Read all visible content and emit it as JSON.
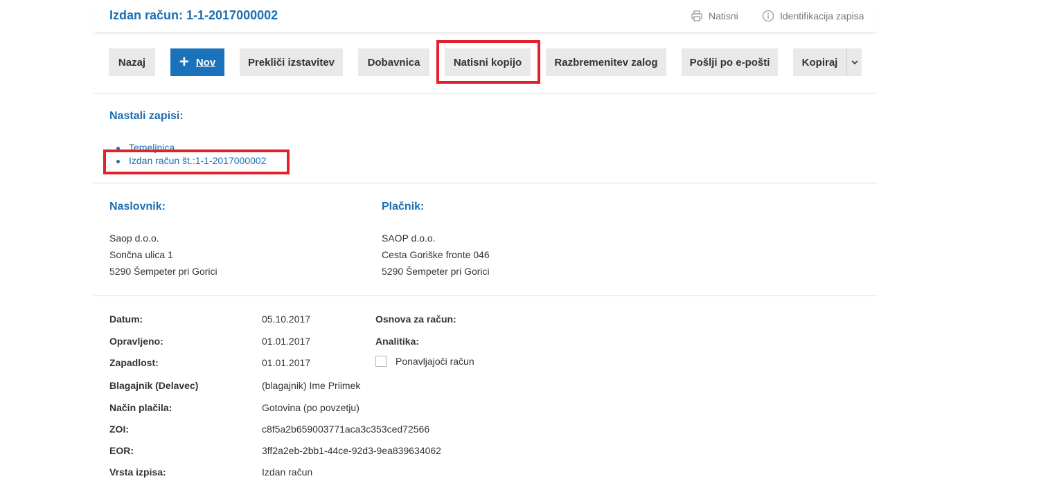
{
  "header": {
    "title": "Izdan račun: 1-1-2017000002",
    "print_label": "Natisni",
    "print_icon": "printer-icon",
    "info_label": "Identifikacija zapisa",
    "info_icon": "info-icon"
  },
  "toolbar": {
    "back": "Nazaj",
    "new": "Nov",
    "new_icon": "plus-icon",
    "cancel_issue": "Prekliči izstavitev",
    "delivery_note": "Dobavnica",
    "print_copy": "Natisni kopijo",
    "release_stock": "Razbremenitev zalog",
    "send_email": "Pošlji po e-pošti",
    "copy": "Kopiraj",
    "copy_menu_icon": "chevron-down-icon"
  },
  "records": {
    "title": "Nastali zapisi:",
    "items": [
      "Temeljnica",
      "Izdan račun št.:1-1-2017000002"
    ]
  },
  "recipient": {
    "title": "Naslovnik:",
    "name": "Saop d.o.o.",
    "street": "Sončna ulica 1",
    "city": "5290 Šempeter pri Gorici"
  },
  "payer": {
    "title": "Plačnik:",
    "name": "SAOP d.o.o.",
    "street": "Cesta Goriške fronte 046",
    "city": "5290 Šempeter pri Gorici"
  },
  "details": {
    "date_label": "Datum:",
    "date_value": "05.10.2017",
    "done_label": "Opravljeno:",
    "done_value": "01.01.2017",
    "due_label": "Zapadlost:",
    "due_value": "01.01.2017",
    "cashier_label": "Blagajnik (Delavec)",
    "cashier_value": "(blagajnik) Ime Priimek",
    "payment_label": "Način plačila:",
    "payment_value": "Gotovina (po povzetju)",
    "zoi_label": "ZOI:",
    "zoi_value": "c8f5a2b659003771aca3c353ced72566",
    "eor_label": "EOR:",
    "eor_value": "3ff2a2eb-2bb1-44ce-92d3-9ea839634062",
    "type_label": "Vrsta izpisa:",
    "type_value": "Izdan račun",
    "basis_label": "Osnova za račun:",
    "analytics_label": "Analitika:",
    "recurring_label": "Ponavljajoči račun",
    "recurring_checked": false
  },
  "colors": {
    "accent": "#1a6fb5",
    "primary_button": "#1a72bb",
    "highlight": "#e2212a",
    "button_bg": "#e9e9e9"
  }
}
